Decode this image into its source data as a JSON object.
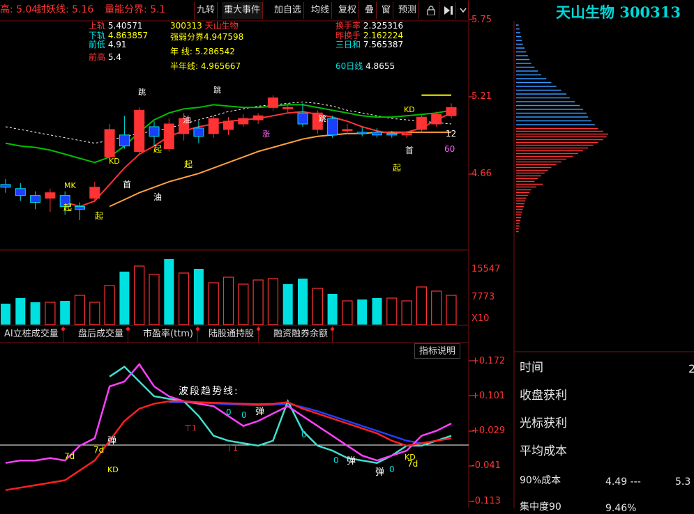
{
  "header": {
    "high_label": "高: 5.04",
    "seal_label": "封妖线: 5.16",
    "volume_label": "量能分界: 5.1"
  },
  "toolbar": {
    "items": [
      "九转",
      "重大事件",
      "加自选",
      "均线",
      "复权",
      "叠",
      "窗",
      "预测"
    ],
    "lock_label": "🔒",
    "nav_icons": "▶▌"
  },
  "stock_title": "天山生物 300313",
  "info_left": [
    {
      "label": "上轨",
      "value": "5.40571"
    },
    {
      "label": "下轨",
      "value": "4.863857"
    },
    {
      "label": "前低",
      "value": "4.91"
    },
    {
      "label": "前高",
      "value": "5.4"
    }
  ],
  "info_mid": {
    "code": "300313",
    "name": "天山生物",
    "strong_weak": "强弱分界4.947598",
    "year_line": "年  线: 5.286542",
    "half_year_line": "半年线: 4.965667"
  },
  "info_right": {
    "turnover_label": "换手率",
    "turnover_value": "2.325316",
    "prev_turnover_label": "昨换手",
    "prev_turnover_value": "2.162224",
    "three_day_label": "三日和",
    "three_day_value": "7.565387",
    "ma60_label": "60日线",
    "ma60_value": "4.8655"
  },
  "price_axis": [
    "5.75",
    "5.21",
    "4.66"
  ],
  "volume_axis": [
    "15547",
    "7773",
    "X10"
  ],
  "indicator_axis": [
    "+0.172",
    "+0.101",
    "+0.029",
    "-0.041",
    "-0.113"
  ],
  "indicator_tabs": [
    "AI立桩成交量",
    "盘后成交量",
    "市盈率(ttm)",
    "陆股通持股",
    "融资融券余额"
  ],
  "indicator_help": "指标说明",
  "wave_title": "波段趋势线:",
  "chart_markers": {
    "qi": "起",
    "you": "油",
    "shou": "首",
    "tiao": "跳",
    "dan": "弹",
    "zhang": "涨",
    "kd": "KD",
    "mk": "MK",
    "seven_d": "7d",
    "zero": "0",
    "yi": "ㄒ1",
    "twelve": "12",
    "sixty": "60"
  },
  "right_panel": {
    "time_label": "时间",
    "close_profit_label": "收盘获利",
    "cursor_profit_label": "光标获利",
    "avg_cost_label": "平均成本",
    "cost90_label": "90%成本",
    "cost90_value": "4.49 ---",
    "cost90_value2": "5.3",
    "concentration_label": "集中度90",
    "concentration_value": "9.46%",
    "time_value": "2"
  },
  "colors": {
    "up": "#ff3333",
    "down": "#00e0e0",
    "ma_yellow": "#ffff00",
    "ma_white": "#ffffff",
    "ma_green": "#00c000",
    "ma_magenta": "#ff00ff",
    "ma_orange": "#ffa040",
    "ma_blue": "#2040ff"
  },
  "chart_data": {
    "type": "candlestick",
    "candles": [
      {
        "o": 4.58,
        "c": 4.56,
        "h": 4.62,
        "l": 4.52
      },
      {
        "o": 4.55,
        "c": 4.5,
        "h": 4.59,
        "l": 4.46
      },
      {
        "o": 4.5,
        "c": 4.45,
        "h": 4.53,
        "l": 4.4
      },
      {
        "o": 4.48,
        "c": 4.52,
        "h": 4.55,
        "l": 4.38
      },
      {
        "o": 4.5,
        "c": 4.42,
        "h": 4.53,
        "l": 4.36
      },
      {
        "o": 4.42,
        "c": 4.4,
        "h": 4.45,
        "l": 4.32
      },
      {
        "o": 4.48,
        "c": 4.56,
        "h": 4.6,
        "l": 4.45
      },
      {
        "o": 4.78,
        "c": 4.98,
        "h": 5.02,
        "l": 4.76
      },
      {
        "o": 4.94,
        "c": 4.86,
        "h": 5.08,
        "l": 4.84
      },
      {
        "o": 4.82,
        "c": 5.12,
        "h": 5.14,
        "l": 4.8
      },
      {
        "o": 5.0,
        "c": 4.93,
        "h": 5.04,
        "l": 4.86
      },
      {
        "o": 4.84,
        "c": 5.02,
        "h": 5.06,
        "l": 4.82
      },
      {
        "o": 4.95,
        "c": 5.06,
        "h": 5.1,
        "l": 4.9
      },
      {
        "o": 4.99,
        "c": 4.93,
        "h": 5.04,
        "l": 4.88
      },
      {
        "o": 4.95,
        "c": 5.06,
        "h": 5.08,
        "l": 4.92
      },
      {
        "o": 4.98,
        "c": 5.04,
        "h": 5.07,
        "l": 4.94
      },
      {
        "o": 5.02,
        "c": 5.06,
        "h": 5.09,
        "l": 5.0
      },
      {
        "o": 5.05,
        "c": 5.08,
        "h": 5.1,
        "l": 5.02
      },
      {
        "o": 5.14,
        "c": 5.21,
        "h": 5.23,
        "l": 5.12
      },
      {
        "o": 5.13,
        "c": 5.14,
        "h": 5.17,
        "l": 5.1
      },
      {
        "o": 5.1,
        "c": 5.02,
        "h": 5.17,
        "l": 5.0
      },
      {
        "o": 4.98,
        "c": 5.1,
        "h": 5.12,
        "l": 4.95
      },
      {
        "o": 5.06,
        "c": 4.94,
        "h": 5.08,
        "l": 4.92
      },
      {
        "o": 4.98,
        "c": 4.98,
        "h": 5.02,
        "l": 4.95
      },
      {
        "o": 4.96,
        "c": 4.95,
        "h": 5.0,
        "l": 4.93
      },
      {
        "o": 4.96,
        "c": 4.94,
        "h": 4.99,
        "l": 4.92
      },
      {
        "o": 4.95,
        "c": 4.94,
        "h": 4.97,
        "l": 4.92
      },
      {
        "o": 4.94,
        "c": 4.95,
        "h": 4.97,
        "l": 4.92
      },
      {
        "o": 4.98,
        "c": 5.07,
        "h": 5.09,
        "l": 4.96
      },
      {
        "o": 5.02,
        "c": 5.09,
        "h": 5.11,
        "l": 5.0
      },
      {
        "o": 5.08,
        "c": 5.14,
        "h": 5.17,
        "l": 5.06
      }
    ],
    "volume_candles_up": [
      false,
      false,
      false,
      true,
      false,
      true,
      true,
      true,
      false,
      true,
      true,
      false,
      true,
      false,
      true,
      true,
      true,
      true,
      true,
      false,
      false,
      true,
      false,
      true,
      false,
      false,
      true,
      true,
      true,
      true,
      true
    ],
    "volumes": [
      1500,
      1900,
      1600,
      1600,
      1700,
      2100,
      1600,
      2800,
      3800,
      4200,
      3600,
      4700,
      3700,
      4000,
      3000,
      3400,
      2900,
      3200,
      3300,
      2900,
      3300,
      2600,
      2200,
      1700,
      1800,
      1900,
      1900,
      1700,
      2700,
      2400,
      2100
    ],
    "ma_yellow": [
      null,
      null,
      null,
      null,
      null,
      null,
      null,
      null,
      null,
      null,
      null,
      null,
      null,
      null,
      null,
      null,
      null,
      null,
      null,
      null,
      null,
      null,
      null,
      null,
      null,
      null,
      null,
      null,
      5.23,
      5.23,
      5.23
    ],
    "ma_red": [
      null,
      null,
      null,
      null,
      4.45,
      4.42,
      4.46,
      4.58,
      4.7,
      4.8,
      4.86,
      4.93,
      4.97,
      5.0,
      5.02,
      5.04,
      5.05,
      5.06,
      5.08,
      5.1,
      5.11,
      5.09,
      5.07,
      5.04,
      5.0,
      4.97,
      4.95,
      4.96,
      4.99,
      5.05,
      5.1
    ],
    "ma_green": [
      4.88,
      4.86,
      4.85,
      4.83,
      4.8,
      4.77,
      4.74,
      4.78,
      4.86,
      4.96,
      5.05,
      5.1,
      5.13,
      5.14,
      5.16,
      5.15,
      5.14,
      5.14,
      5.15,
      5.16,
      5.16,
      5.14,
      5.12,
      5.1,
      5.08,
      5.07,
      5.07,
      5.08,
      5.09,
      5.1,
      5.12
    ],
    "ma_orange": [
      null,
      null,
      null,
      null,
      null,
      null,
      null,
      4.42,
      4.47,
      4.52,
      4.56,
      4.6,
      4.63,
      4.66,
      4.7,
      4.74,
      4.78,
      4.82,
      4.85,
      4.88,
      4.91,
      4.93,
      4.94,
      4.95,
      4.95,
      4.96,
      4.96,
      4.96,
      4.96,
      4.96,
      4.96
    ],
    "ma_white": [
      5.0,
      4.98,
      4.96,
      4.94,
      4.92,
      4.9,
      4.88,
      4.9,
      4.93,
      4.95,
      4.97,
      4.99,
      5.02,
      5.05,
      5.08,
      5.11,
      5.13,
      5.15,
      5.16,
      5.17,
      5.18,
      5.17,
      5.15,
      5.12,
      5.1,
      5.08,
      5.06,
      5.05,
      5.04,
      5.03,
      5.02
    ],
    "ylim": [
      4.25,
      5.78
    ],
    "chip_distribution": {
      "up_color": "#ff3333",
      "down_color": "#3399ff",
      "levels_down": [
        0.15,
        0.2,
        0.25,
        0.3,
        0.35,
        0.4,
        0.5,
        0.6,
        0.7,
        0.8,
        0.9,
        1.1,
        1.3,
        1.5,
        1.8,
        2.1,
        2.4,
        2.7,
        3.0,
        3.2,
        3.5,
        3.8,
        4.0,
        4.2,
        4.3,
        4.5,
        4.7
      ],
      "levels_up": [
        4.9,
        5.2,
        5.5,
        5.4,
        5.2,
        4.9,
        4.6,
        4.3,
        4.0,
        3.7,
        3.4,
        3.0,
        2.7,
        2.4,
        2.1,
        1.9,
        1.7,
        1.5,
        1.3,
        1.1,
        1.6,
        1.2,
        0.9,
        0.8,
        0.7,
        0.6,
        0.55,
        0.5,
        0.45,
        0.4,
        0.35,
        0.3,
        0.3,
        0.25,
        0.2,
        0.2,
        0.15,
        0.15
      ]
    },
    "indicator": {
      "ylim": [
        -0.113,
        0.172
      ],
      "red": [
        -0.09,
        -0.085,
        -0.08,
        -0.075,
        -0.07,
        -0.05,
        -0.03,
        0.01,
        0.05,
        0.075,
        0.085,
        0.09,
        0.09,
        0.088,
        0.087,
        0.086,
        0.085,
        0.084,
        0.085,
        0.088,
        0.075,
        0.065,
        0.055,
        0.045,
        0.035,
        0.025,
        0.01,
        0.0,
        0.005,
        0.01,
        0.015
      ],
      "magenta": [
        -0.035,
        -0.03,
        -0.03,
        -0.025,
        -0.03,
        0.0,
        0.015,
        0.12,
        0.13,
        0.165,
        0.12,
        0.1,
        0.09,
        0.085,
        0.08,
        0.06,
        0.04,
        0.05,
        0.065,
        0.08,
        0.06,
        0.04,
        0.02,
        0.0,
        -0.02,
        -0.03,
        -0.02,
        -0.01,
        0.02,
        0.03,
        0.045
      ],
      "cyan": [
        null,
        null,
        null,
        null,
        null,
        null,
        null,
        0.14,
        0.16,
        0.13,
        0.1,
        0.095,
        0.09,
        0.06,
        0.02,
        0.01,
        0.005,
        0.0,
        0.01,
        0.09,
        0.03,
        0.0,
        -0.01,
        -0.025,
        -0.03,
        -0.035,
        -0.02,
        0.0,
        0.0,
        0.01,
        0.02
      ],
      "blue": [
        null,
        null,
        null,
        null,
        null,
        null,
        null,
        null,
        null,
        null,
        null,
        0.088,
        0.088,
        0.087,
        0.086,
        0.084,
        0.083,
        0.082,
        0.083,
        0.085,
        0.078,
        0.07,
        0.06,
        0.05,
        0.04,
        0.03,
        0.02,
        0.01,
        0.005,
        0.01,
        0.015
      ]
    }
  }
}
